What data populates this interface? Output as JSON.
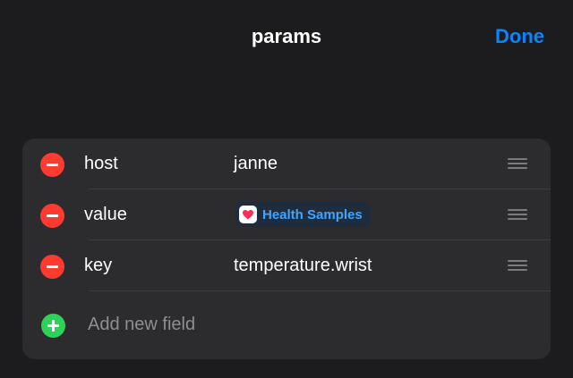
{
  "header": {
    "title": "params",
    "done_label": "Done"
  },
  "fields": [
    {
      "key": "host",
      "value": "janne",
      "value_type": "text"
    },
    {
      "key": "value",
      "value": "Health Samples",
      "value_type": "token",
      "icon": "heart-icon"
    },
    {
      "key": "key",
      "value": "temperature.wrist",
      "value_type": "text"
    }
  ],
  "add_field": {
    "label": "Add new field"
  },
  "colors": {
    "accent": "#0a84ff",
    "remove": "#ff3b30",
    "add": "#30d158",
    "background": "#1c1c1e",
    "card": "#2c2c2e"
  }
}
